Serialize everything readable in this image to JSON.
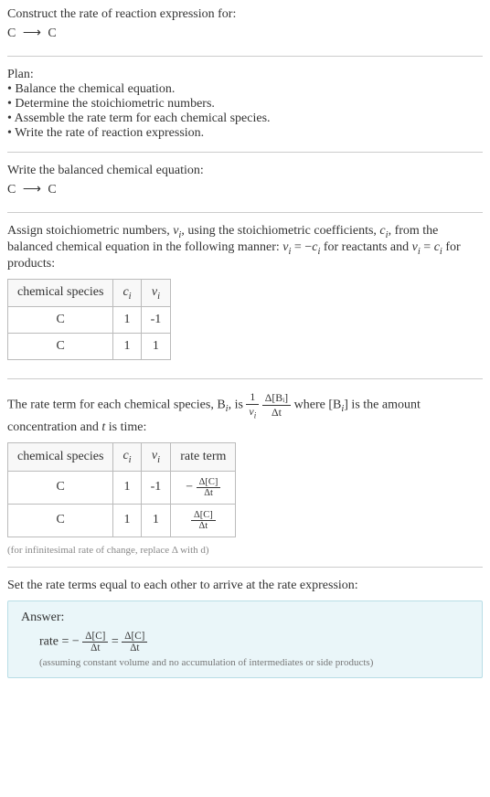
{
  "title": "Construct the rate of reaction expression for:",
  "reaction_left": "C",
  "arrow": "⟶",
  "reaction_right": "C",
  "plan_header": "Plan:",
  "plan_items": [
    "Balance the chemical equation.",
    "Determine the stoichiometric numbers.",
    "Assemble the rate term for each chemical species.",
    "Write the rate of reaction expression."
  ],
  "balanced_intro": "Write the balanced chemical equation:",
  "assign_intro_1": "Assign stoichiometric numbers, ",
  "nu_i": "ν",
  "assign_intro_2": ", using the stoichiometric coefficients, ",
  "c_i": "c",
  "assign_intro_3": ", from the balanced chemical equation in the following manner: ",
  "reactant_rule": " for reactants and ",
  "product_rule": " for products:",
  "table1": {
    "headers": [
      "chemical species",
      "cᵢ",
      "νᵢ"
    ],
    "rows": [
      [
        "C",
        "1",
        "-1"
      ],
      [
        "C",
        "1",
        "1"
      ]
    ]
  },
  "rate_term_intro_1": "The rate term for each chemical species, B",
  "rate_term_intro_2": ", is ",
  "rate_term_intro_3": " where [B",
  "rate_term_intro_4": "] is the amount concentration and ",
  "t_var": "t",
  "rate_term_intro_5": " is time:",
  "table2": {
    "headers": [
      "chemical species",
      "cᵢ",
      "νᵢ",
      "rate term"
    ],
    "rows": [
      {
        "species": "C",
        "ci": "1",
        "nui": "-1",
        "sign": "−",
        "num": "Δ[C]",
        "den": "Δt"
      },
      {
        "species": "C",
        "ci": "1",
        "nui": "1",
        "sign": "",
        "num": "Δ[C]",
        "den": "Δt"
      }
    ]
  },
  "infinitesimal_note": "(for infinitesimal rate of change, replace Δ with d)",
  "set_equal": "Set the rate terms equal to each other to arrive at the rate expression:",
  "answer_label": "Answer:",
  "rate_word": "rate = ",
  "minus": "−",
  "eq": " = ",
  "delta_c": "Δ[C]",
  "delta_t": "Δt",
  "assumption": "(assuming constant volume and no accumulation of intermediates or side products)",
  "bullet": "• ",
  "i_sub": "i",
  "one_over": "1",
  "delta_bi": "Δ[Bᵢ]",
  "eq_neg_ci": " = −",
  "eq_ci": " = "
}
